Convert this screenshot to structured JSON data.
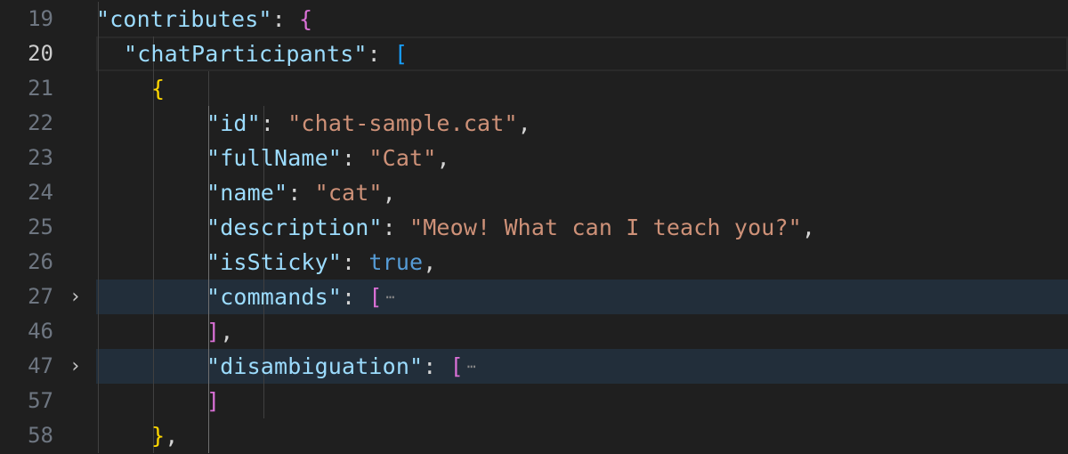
{
  "editor": {
    "lines": [
      {
        "num": "19",
        "indent": 2,
        "active_num": false,
        "collapsed": false,
        "current": false,
        "fold": "",
        "guides": [
          1
        ],
        "tokens": [
          [
            "k",
            "\"contributes\""
          ],
          [
            "p",
            ": "
          ],
          [
            "b2",
            "{"
          ]
        ]
      },
      {
        "num": "20",
        "indent": 3,
        "active_num": true,
        "collapsed": false,
        "current": true,
        "fold": "",
        "guides": [
          1,
          2
        ],
        "tokens": [
          [
            "k",
            "\"chatParticipants\""
          ],
          [
            "p",
            ": "
          ],
          [
            "b3",
            "["
          ]
        ]
      },
      {
        "num": "21",
        "indent": 4,
        "active_num": false,
        "collapsed": false,
        "current": false,
        "fold": "",
        "guides": [
          1,
          2,
          3
        ],
        "tokens": [
          [
            "b1",
            "{"
          ]
        ]
      },
      {
        "num": "22",
        "indent": 6,
        "active_num": false,
        "collapsed": false,
        "current": false,
        "fold": "",
        "guides": [
          1,
          2,
          3,
          4
        ],
        "tokens": [
          [
            "k",
            "\"id\""
          ],
          [
            "p",
            ": "
          ],
          [
            "s",
            "\"chat-sample.cat\""
          ],
          [
            "p",
            ","
          ]
        ]
      },
      {
        "num": "23",
        "indent": 6,
        "active_num": false,
        "collapsed": false,
        "current": false,
        "fold": "",
        "guides": [
          1,
          2,
          3,
          4
        ],
        "tokens": [
          [
            "k",
            "\"fullName\""
          ],
          [
            "p",
            ": "
          ],
          [
            "s",
            "\"Cat\""
          ],
          [
            "p",
            ","
          ]
        ]
      },
      {
        "num": "24",
        "indent": 6,
        "active_num": false,
        "collapsed": false,
        "current": false,
        "fold": "",
        "guides": [
          1,
          2,
          3,
          4
        ],
        "tokens": [
          [
            "k",
            "\"name\""
          ],
          [
            "p",
            ": "
          ],
          [
            "s",
            "\"cat\""
          ],
          [
            "p",
            ","
          ]
        ]
      },
      {
        "num": "25",
        "indent": 6,
        "active_num": false,
        "collapsed": false,
        "current": false,
        "fold": "",
        "guides": [
          1,
          2,
          3,
          4
        ],
        "tokens": [
          [
            "k",
            "\"description\""
          ],
          [
            "p",
            ": "
          ],
          [
            "s",
            "\"Meow! What can I teach you?\""
          ],
          [
            "p",
            ","
          ]
        ]
      },
      {
        "num": "26",
        "indent": 6,
        "active_num": false,
        "collapsed": false,
        "current": false,
        "fold": "",
        "guides": [
          1,
          2,
          3,
          4
        ],
        "tokens": [
          [
            "k",
            "\"isSticky\""
          ],
          [
            "p",
            ": "
          ],
          [
            "kw",
            "true"
          ],
          [
            "p",
            ","
          ]
        ]
      },
      {
        "num": "27",
        "indent": 6,
        "active_num": false,
        "collapsed": true,
        "current": false,
        "fold": "›",
        "guides": [
          1,
          2,
          3,
          4
        ],
        "tokens": [
          [
            "k",
            "\"commands\""
          ],
          [
            "p",
            ": "
          ],
          [
            "b2",
            "["
          ]
        ],
        "ellipsis": "⋯"
      },
      {
        "num": "46",
        "indent": 6,
        "active_num": false,
        "collapsed": false,
        "current": false,
        "fold": "",
        "guides": [
          1,
          2,
          3,
          4
        ],
        "tokens": [
          [
            "b2",
            "]"
          ],
          [
            "p",
            ","
          ]
        ]
      },
      {
        "num": "47",
        "indent": 6,
        "active_num": false,
        "collapsed": true,
        "current": false,
        "fold": "›",
        "guides": [
          1,
          2,
          3,
          4
        ],
        "tokens": [
          [
            "k",
            "\"disambiguation\""
          ],
          [
            "p",
            ": "
          ],
          [
            "b2",
            "["
          ]
        ],
        "ellipsis": "⋯"
      },
      {
        "num": "57",
        "indent": 6,
        "active_num": false,
        "collapsed": false,
        "current": false,
        "fold": "",
        "guides": [
          1,
          2,
          3,
          4
        ],
        "tokens": [
          [
            "b2",
            "]"
          ]
        ]
      },
      {
        "num": "58",
        "indent": 4,
        "active_num": false,
        "collapsed": false,
        "current": false,
        "fold": "",
        "guides": [
          1,
          2,
          3
        ],
        "tokens": [
          [
            "b1",
            "}"
          ],
          [
            "p",
            ","
          ]
        ]
      }
    ]
  },
  "icons": {
    "fold": "chevron-right-icon",
    "ellipsis": "ellipsis-icon"
  },
  "colors": {
    "background": "#1f1f1f",
    "key": "#9cdcfe",
    "string": "#ce9178",
    "punctuation": "#d4d4d4",
    "bracket_level_1": "#ffd700",
    "bracket_level_2": "#da70d6",
    "bracket_level_3": "#179fff",
    "keyword": "#569cd6",
    "line_number": "#6e7681",
    "line_number_active": "#cccccc",
    "folded_line_highlight": "#222e3a"
  }
}
